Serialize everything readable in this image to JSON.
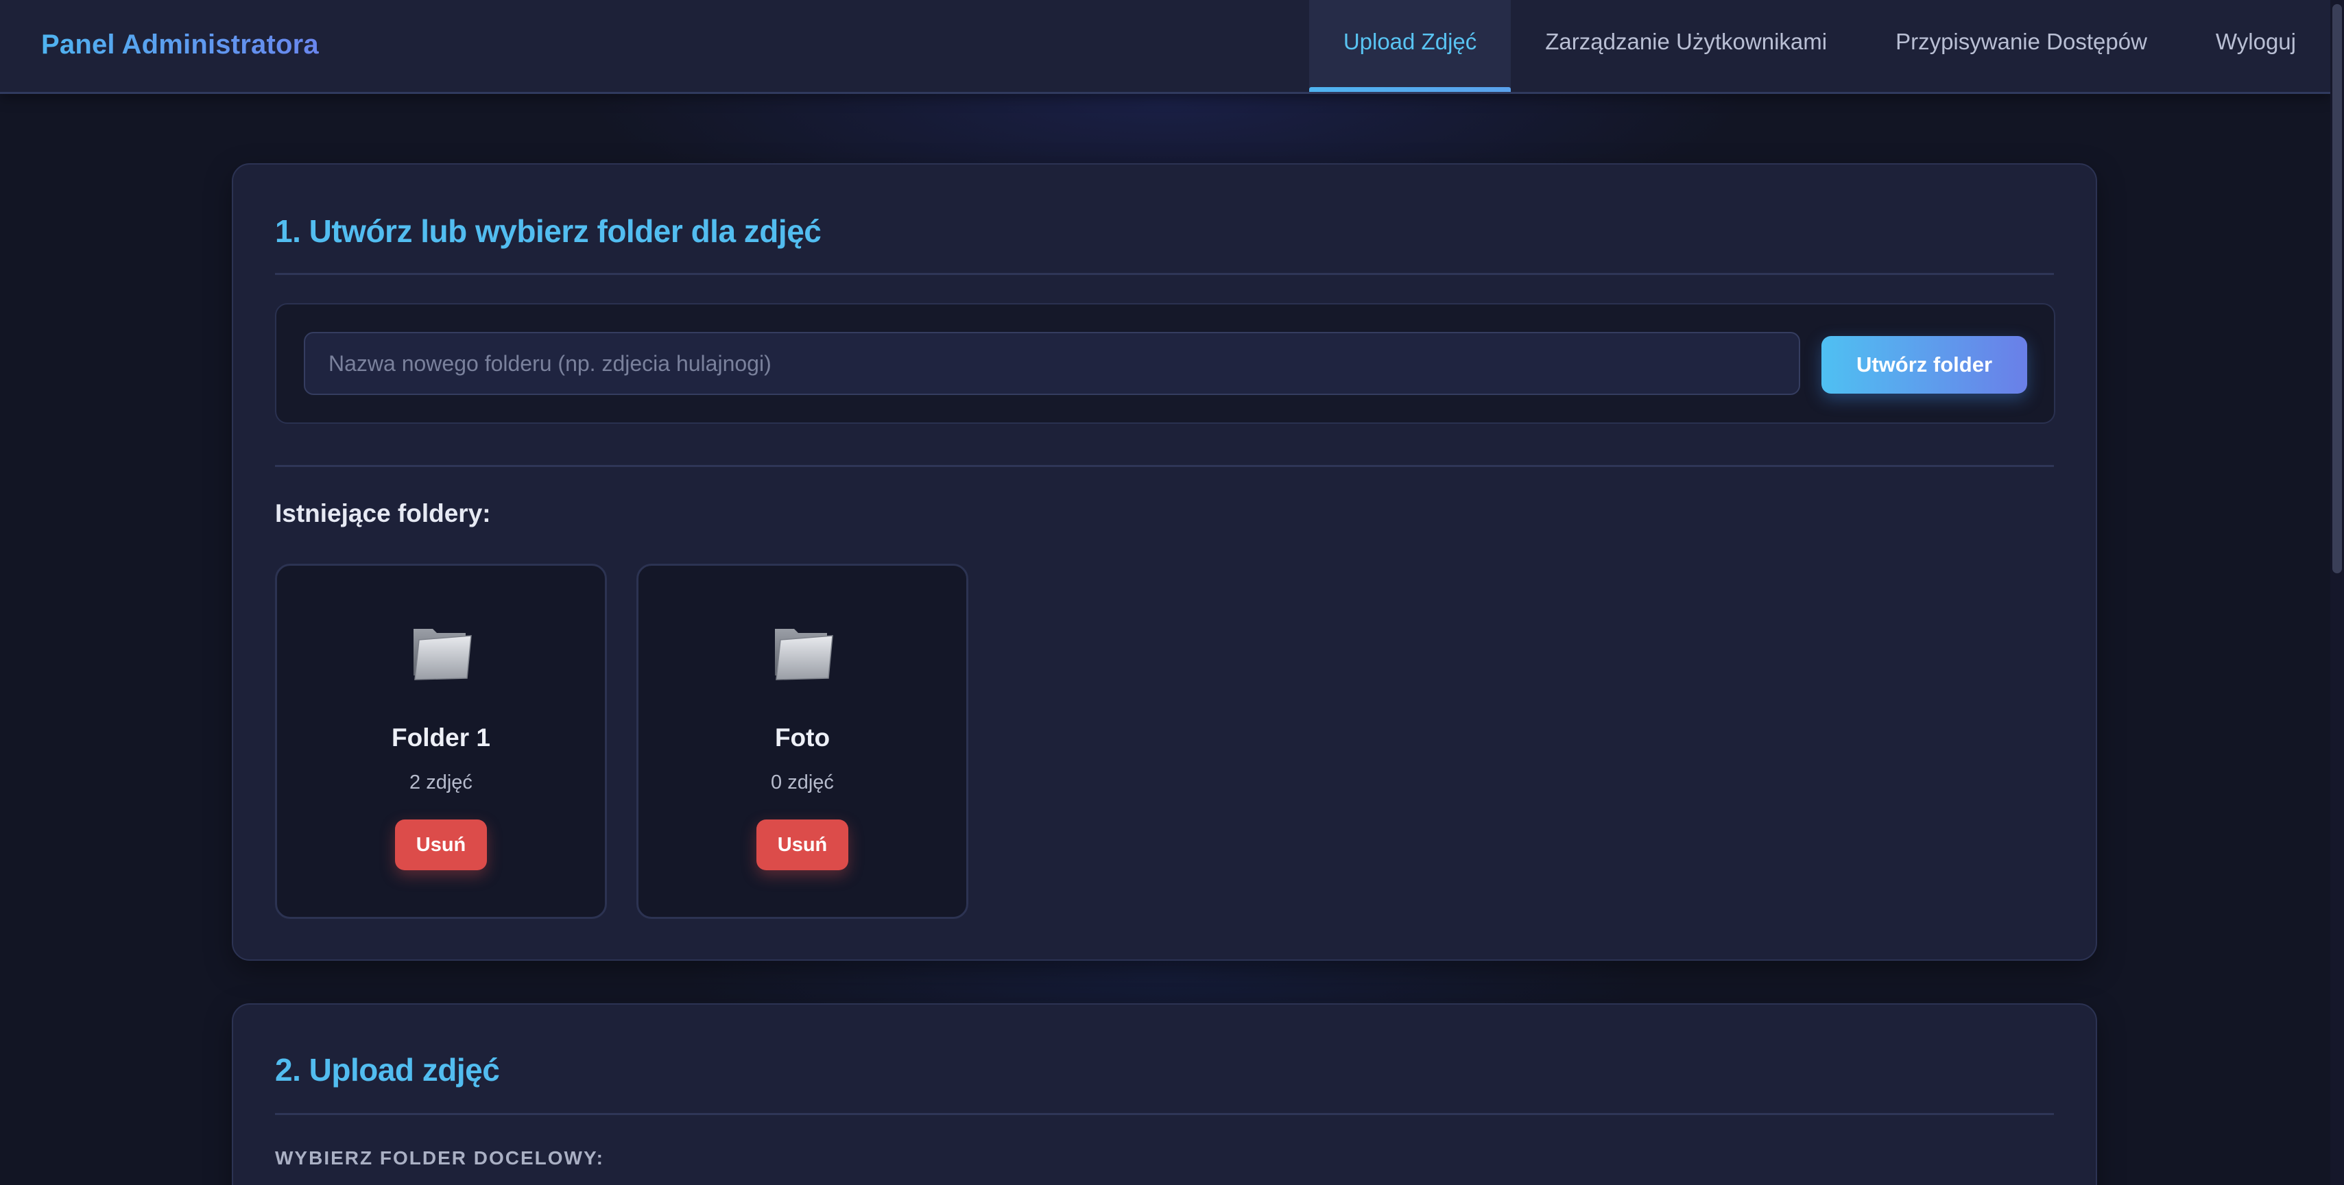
{
  "header": {
    "brand": "Panel Administratora",
    "nav": [
      {
        "label": "Upload Zdjęć",
        "active": true
      },
      {
        "label": "Zarządzanie Użytkownikami",
        "active": false
      },
      {
        "label": "Przypisywanie Dostępów",
        "active": false
      },
      {
        "label": "Wyloguj",
        "active": false
      }
    ]
  },
  "create_section": {
    "title": "1. Utwórz lub wybierz folder dla zdjęć",
    "input_value": "",
    "input_placeholder": "Nazwa nowego folderu (np. zdjecia hulajnogi)",
    "create_button": "Utwórz folder",
    "existing_label": "Istniejące foldery:",
    "folders": [
      {
        "name": "Folder 1",
        "count": "2 zdjęć",
        "delete_label": "Usuń",
        "icon": "folder-icon"
      },
      {
        "name": "Foto",
        "count": "0 zdjęć",
        "delete_label": "Usuń",
        "icon": "folder-icon"
      }
    ]
  },
  "upload_section": {
    "title": "2. Upload zdjęć",
    "target_folder_label": "WYBIERZ FOLDER DOCELOWY:"
  },
  "colors": {
    "accent": "#52bdf0",
    "danger": "#dc4c4a",
    "background": "#121524",
    "card": "#1d2139"
  }
}
